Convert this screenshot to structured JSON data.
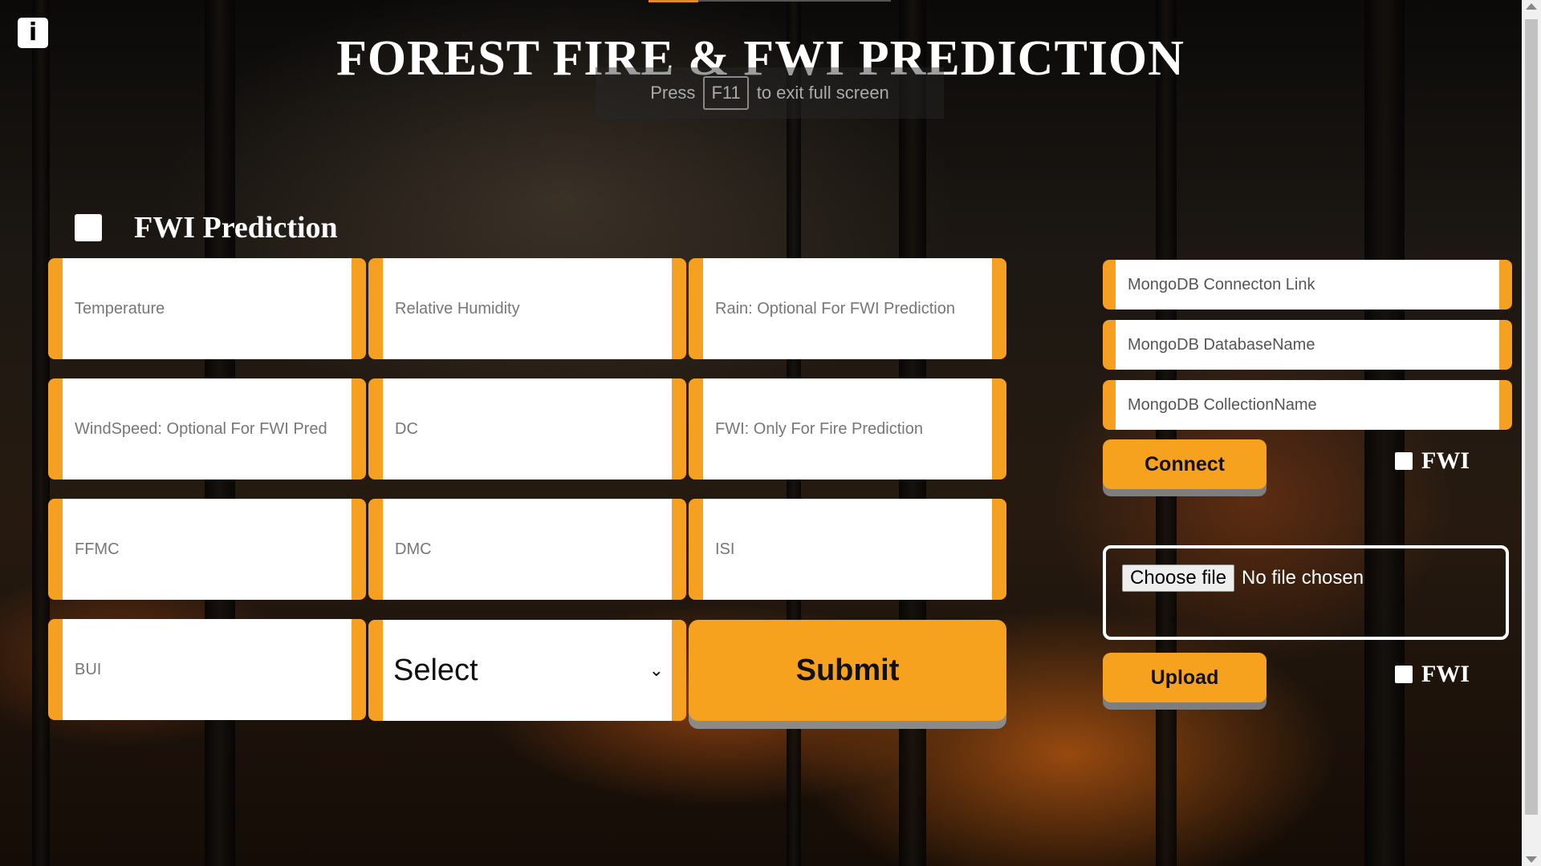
{
  "header": {
    "title": "FOREST FIRE & FWI PREDICTION",
    "fullscreen_press": "Press",
    "fullscreen_key": "F11",
    "fullscreen_suffix": "to exit full screen",
    "info_icon_label": "i"
  },
  "fwi_toggle": {
    "label": "FWI Prediction",
    "checked": false
  },
  "fields": {
    "temperature": "Temperature",
    "humidity": "Relative Humidity",
    "rain": "Rain: Optional For FWI Prediction",
    "windspeed": "WindSpeed: Optional For FWI Pred",
    "dc": "DC",
    "fwi": "FWI: Only For Fire Prediction",
    "ffmc": "FFMC",
    "dmc": "DMC",
    "isi": "ISI",
    "bui": "BUI"
  },
  "select": {
    "value": "Select"
  },
  "submit_label": "Submit",
  "mongo": {
    "link_placeholder": "MongoDB Connecton Link",
    "db_placeholder": "MongoDB DatabaseName",
    "collection_placeholder": "MongoDB CollectionName",
    "connect_label": "Connect",
    "connect_fwi_label": "FWI"
  },
  "upload": {
    "choose_file_label": "Choose file",
    "no_file_text": "No file chosen",
    "upload_label": "Upload",
    "upload_fwi_label": "FWI"
  },
  "colors": {
    "accent": "#f5a020",
    "button": "#f7a21e"
  }
}
